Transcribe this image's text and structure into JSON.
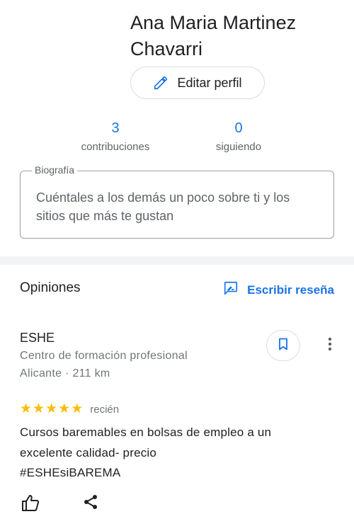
{
  "profile": {
    "name_line1": "Ana Maria Martinez",
    "name_line2": "Chavarri",
    "edit_label": "Editar perfil"
  },
  "stats": {
    "contributions_count": "3",
    "contributions_label": "contribuciones",
    "following_count": "0",
    "following_label": "siguiendo"
  },
  "bio": {
    "label": "Biografía",
    "placeholder": "Cuéntales a los demás un poco sobre ti y los sitios que más te gustan"
  },
  "reviews": {
    "title": "Opiniones",
    "write_label": "Escribir reseña",
    "items": [
      {
        "place": "ESHE",
        "category": "Centro de formación profesional",
        "location": "Alicante · 211 km",
        "rating": 5,
        "time": "recién",
        "text_line1": "Cursos baremables en bolsas de empleo a un",
        "text_line2": "excelente calidad- precio",
        "text_line3": "#ESHEsiBAREMA"
      }
    ]
  },
  "icons": {
    "edit": "pencil-icon",
    "write_review": "rate-review-icon",
    "save": "bookmark-icon",
    "more": "more-vert-icon",
    "like": "thumb-up-icon",
    "share": "share-icon"
  },
  "colors": {
    "accent": "#1a73e8",
    "star": "#fbbc04",
    "text": "#202124",
    "secondary": "#70757a"
  }
}
